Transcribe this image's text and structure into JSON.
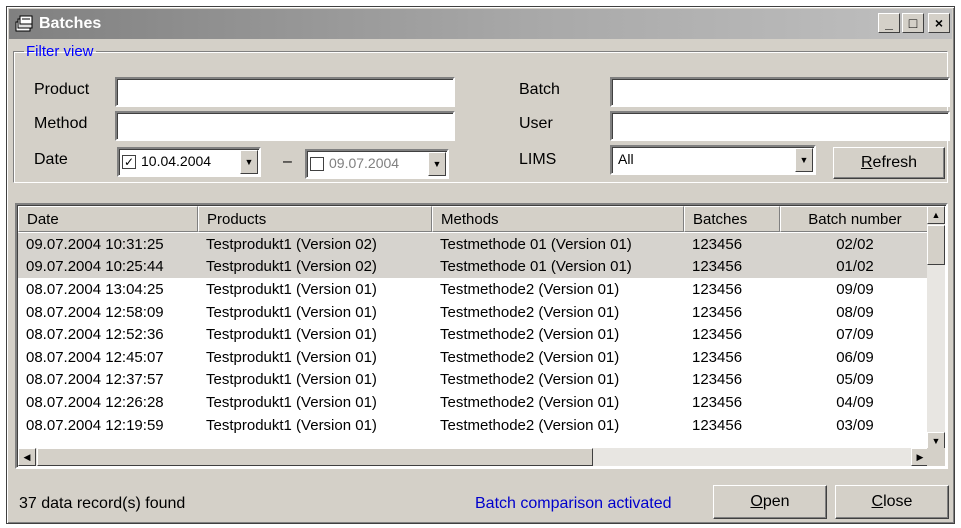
{
  "window": {
    "title": "Batches",
    "minimize": "_",
    "maximize": "□",
    "close": "×"
  },
  "filter": {
    "legend": "Filter view",
    "product_label": "Product",
    "product_value": "",
    "method_label": "Method",
    "method_value": "",
    "date_label": "Date",
    "date_from": "10.04.2004",
    "date_from_checked": true,
    "date_separator": "–",
    "date_to": "09.07.2004",
    "date_to_checked": false,
    "batch_label": "Batch",
    "batch_value": "",
    "user_label": "User",
    "user_value": "",
    "lims_label": "LIMS",
    "lims_value": "All",
    "refresh_label": "Refresh",
    "refresh_mnemonic": "R",
    "refresh_rest": "efresh"
  },
  "table": {
    "columns": [
      "Date",
      "Products",
      "Methods",
      "Batches",
      "Batch number"
    ],
    "rows": [
      {
        "date": "09.07.2004 10:31:25",
        "product": "Testprodukt1 (Version 02)",
        "method": "Testmethode 01 (Version 01)",
        "batch": "123456",
        "number": "02/02",
        "selected": true
      },
      {
        "date": "09.07.2004 10:25:44",
        "product": "Testprodukt1 (Version 02)",
        "method": "Testmethode 01 (Version 01)",
        "batch": "123456",
        "number": "01/02",
        "selected": true
      },
      {
        "date": "08.07.2004 13:04:25",
        "product": "Testprodukt1 (Version 01)",
        "method": "Testmethode2 (Version 01)",
        "batch": "123456",
        "number": "09/09",
        "selected": false
      },
      {
        "date": "08.07.2004 12:58:09",
        "product": "Testprodukt1 (Version 01)",
        "method": "Testmethode2 (Version 01)",
        "batch": "123456",
        "number": "08/09",
        "selected": false
      },
      {
        "date": "08.07.2004 12:52:36",
        "product": "Testprodukt1 (Version 01)",
        "method": "Testmethode2 (Version 01)",
        "batch": "123456",
        "number": "07/09",
        "selected": false
      },
      {
        "date": "08.07.2004 12:45:07",
        "product": "Testprodukt1 (Version 01)",
        "method": "Testmethode2 (Version 01)",
        "batch": "123456",
        "number": "06/09",
        "selected": false
      },
      {
        "date": "08.07.2004 12:37:57",
        "product": "Testprodukt1 (Version 01)",
        "method": "Testmethode2 (Version 01)",
        "batch": "123456",
        "number": "05/09",
        "selected": false
      },
      {
        "date": "08.07.2004 12:26:28",
        "product": "Testprodukt1 (Version 01)",
        "method": "Testmethode2 (Version 01)",
        "batch": "123456",
        "number": "04/09",
        "selected": false
      },
      {
        "date": "08.07.2004 12:19:59",
        "product": "Testprodukt1 (Version 01)",
        "method": "Testmethode2 (Version 01)",
        "batch": "123456",
        "number": "03/09",
        "selected": false
      }
    ]
  },
  "footer": {
    "record_count": "37 data record(s) found",
    "comparison_status": "Batch comparison activated",
    "comparison_color": "#0000cc",
    "open_mnemonic": "O",
    "open_rest": "pen",
    "close_mnemonic": "C",
    "close_rest": "lose"
  },
  "icons": {
    "app": "batches-app-icon",
    "dropdown": "▼",
    "scroll_up": "▲",
    "scroll_down": "▼",
    "scroll_left": "◀",
    "scroll_right": "▶"
  }
}
